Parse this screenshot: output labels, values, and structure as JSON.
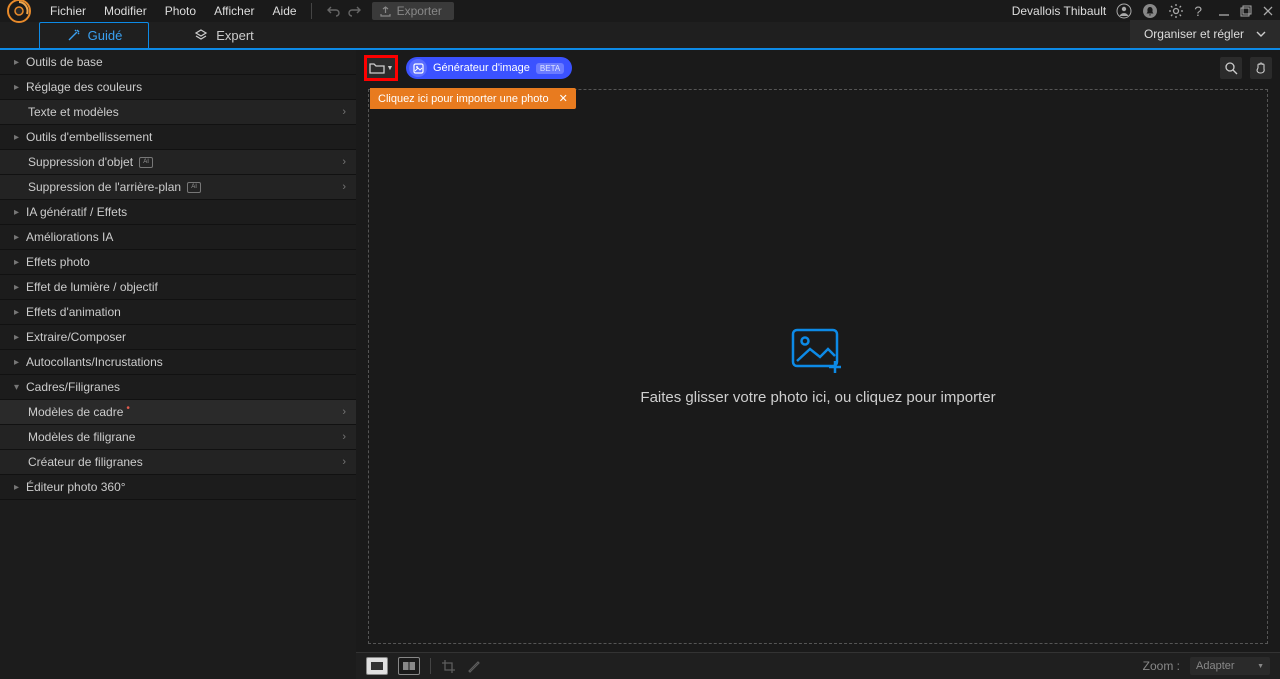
{
  "menu": {
    "items": [
      "Fichier",
      "Modifier",
      "Photo",
      "Afficher",
      "Aide"
    ],
    "export": "Exporter"
  },
  "user": {
    "name": "Devallois Thibault"
  },
  "modes": {
    "guided": "Guidé",
    "expert": "Expert"
  },
  "organize": {
    "label": "Organiser et régler"
  },
  "sidebar": {
    "groups": [
      {
        "label": "Outils de base",
        "expanded": false
      },
      {
        "label": "Réglage des couleurs",
        "expanded": false
      },
      {
        "label": "Texte et modèles",
        "sub": true,
        "chev": true
      },
      {
        "label": "Outils d'embellissement",
        "expanded": false
      },
      {
        "label": "Suppression d'objet",
        "sub": true,
        "chev": true,
        "ai": true
      },
      {
        "label": "Suppression de l'arrière-plan",
        "sub": true,
        "chev": true,
        "ai": true
      },
      {
        "label": "IA génératif / Effets",
        "expanded": false
      },
      {
        "label": "Améliorations IA",
        "expanded": false
      },
      {
        "label": "Effets photo",
        "expanded": false
      },
      {
        "label": "Effet de lumière / objectif",
        "expanded": false
      },
      {
        "label": "Effets d'animation",
        "expanded": false
      },
      {
        "label": "Extraire/Composer",
        "expanded": false
      },
      {
        "label": "Autocollants/Incrustations",
        "expanded": false
      },
      {
        "label": "Cadres/Filigranes",
        "expanded": true
      },
      {
        "label": "Modèles de cadre",
        "sub": true,
        "chev": true,
        "active": true,
        "star": true
      },
      {
        "label": "Modèles de filigrane",
        "sub": true,
        "chev": true
      },
      {
        "label": "Créateur de filigranes",
        "sub": true,
        "chev": true
      },
      {
        "label": "Éditeur photo 360°",
        "expanded": false
      }
    ]
  },
  "toolbar": {
    "generator": "Générateur d'image",
    "beta": "BETA"
  },
  "tooltip": {
    "text": "Cliquez ici pour importer une photo"
  },
  "drop": {
    "text": "Faites glisser votre photo ici, ou cliquez pour importer"
  },
  "bottom": {
    "zoom_label": "Zoom :",
    "zoom_value": "Adapter"
  }
}
